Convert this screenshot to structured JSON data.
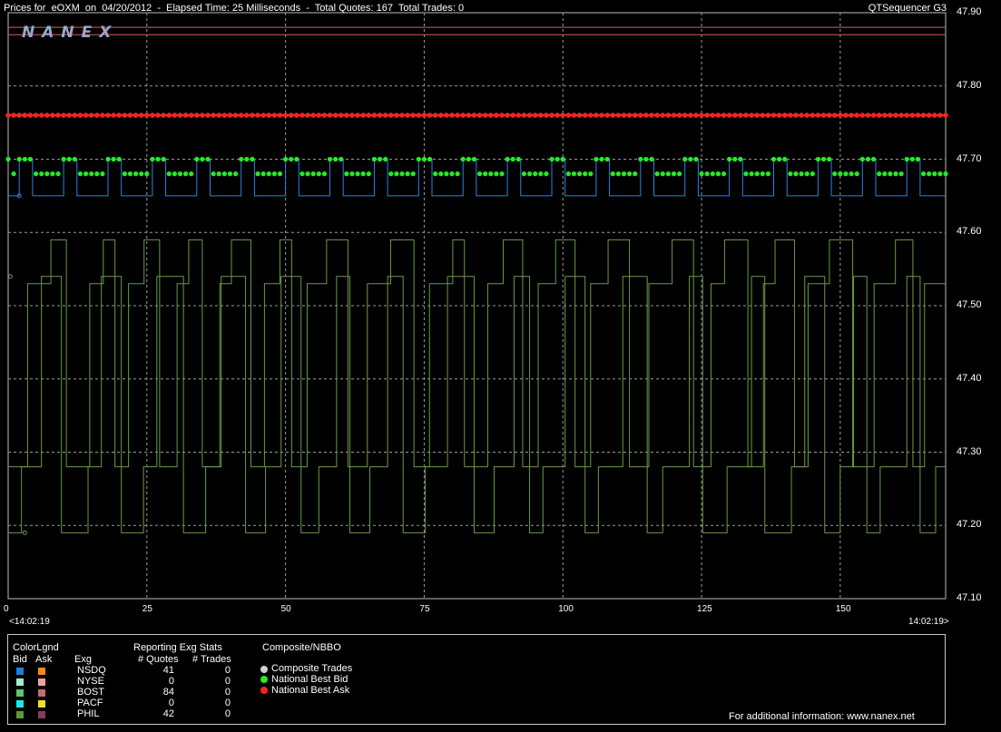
{
  "header": {
    "title": "Prices for  eOXM  on  04/20/2012  -  Elapsed Time: 25 Milliseconds  -  Total Quotes: 167  Total Trades: 0",
    "product": "QTSequencer G3",
    "logo": "NANEX"
  },
  "axis": {
    "time_start": "<14:02:19",
    "time_end": "14:02:19>"
  },
  "chart_data": {
    "type": "line",
    "xlim": [
      0,
      169
    ],
    "ylim": [
      47.1,
      47.9
    ],
    "x_ticks": [
      0,
      25,
      50,
      75,
      100,
      125,
      150
    ],
    "y_ticks": [
      "47.90",
      "47.80",
      "47.70",
      "47.60",
      "47.50",
      "47.40",
      "47.30",
      "47.20",
      "47.10"
    ],
    "grid": true,
    "series": [
      {
        "name": "NSDQ",
        "side": "ask",
        "color": "#d06060",
        "levels": [
          47.87,
          47.88
        ],
        "switch": 1
      },
      {
        "name": "NSDQ",
        "side": "bid",
        "color": "#2a82e4",
        "low": 47.65,
        "high": 47.7,
        "period": 8,
        "duty": 0.3,
        "start": 2
      },
      {
        "name": "National Best Ask",
        "color": "#ff2020",
        "value": 47.76,
        "spacing": 1
      },
      {
        "name": "National Best Bid",
        "color": "#22ee22",
        "low": 47.68,
        "high": 47.7,
        "period": 8,
        "duty": 0.3,
        "start": 2
      },
      {
        "name": "BOST",
        "color": "#6a9a48",
        "bid_levels": [
          47.19,
          47.28,
          47.54
        ],
        "ask_levels": [
          47.28,
          47.53,
          47.59
        ]
      },
      {
        "name": "PHIL",
        "color": "#6a9a48",
        "start_level": 47.19
      }
    ]
  },
  "legend": {
    "color_legend_title": "ColorLgnd",
    "bid_label": "Bid",
    "ask_label": "Ask",
    "exg_col": "Exg",
    "stats_title": "Reporting Exg Stats",
    "quotes_col": "# Quotes",
    "trades_col": "# Trades",
    "composite_title": "Composite/NBBO",
    "rows": [
      {
        "exg": "NSDQ",
        "quotes": "41",
        "trades": "0",
        "bid": "#1f7fe0",
        "ask": "#f08a1a"
      },
      {
        "exg": "NYSE",
        "quotes": "0",
        "trades": "0",
        "bid": "#9ef0c8",
        "ask": "#f0a0a0"
      },
      {
        "exg": "BOST",
        "quotes": "84",
        "trades": "0",
        "bid": "#5cc86a",
        "ask": "#c86a6a"
      },
      {
        "exg": "PACF",
        "quotes": "0",
        "trades": "0",
        "bid": "#22e6e6",
        "ask": "#f0e022"
      },
      {
        "exg": "PHIL",
        "quotes": "42",
        "trades": "0",
        "bid": "#5a9a3a",
        "ask": "#8a3a5a"
      }
    ],
    "composite": [
      {
        "label": "Composite Trades",
        "color": "#d0d0d0"
      },
      {
        "label": "National Best Bid",
        "color": "#22ee22"
      },
      {
        "label": "National Best Ask",
        "color": "#ff2020"
      }
    ],
    "footer": "For additional information: www.nanex.net"
  }
}
